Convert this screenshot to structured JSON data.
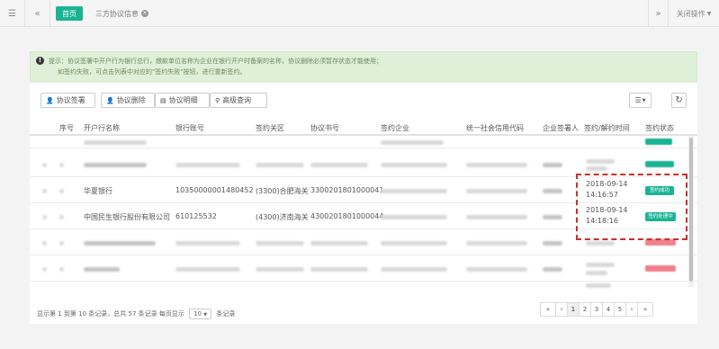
{
  "topbar": {
    "menu_icon": "menu-icon",
    "back_icon": "double-chevron-left-icon",
    "home_tab": "首页",
    "agreement_tab": "三方协议信息",
    "forward_icon": "double-chevron-right-icon",
    "close_ops": "关闭操作"
  },
  "alert": {
    "line1": "提示：协议签署中开户行为银行总行，缴款单位名称为企业在银行开户时备案的名称，协议删除必须暂存状态才能使用；",
    "line2": "如签约失败，可点击列表中对应的\"签约失败\"按钮，进行重新签约。"
  },
  "toolbar": {
    "sign": "协议签署",
    "unsign": "协议删除",
    "detail": "协议明细",
    "search": "高级查询"
  },
  "table": {
    "headers": [
      "序号",
      "开户行名称",
      "银行账号",
      "签约关区",
      "协议书号",
      "签约企业",
      "统一社会信用代码",
      "企业签署人",
      "签约/解约时间",
      "签约状态"
    ],
    "rows": [
      {
        "bank": "华夏银行",
        "account": "10350000001480452",
        "customs": "(3300)合肥海关",
        "protocol": "3300201801000041",
        "time_date": "2018-09-14",
        "time_clock": "14:16:57",
        "status": "签约成功"
      },
      {
        "bank": "中国民生银行股份有限公司",
        "account": "610125532",
        "customs": "(4300)济南海关",
        "protocol": "4300201801000044",
        "time_date": "2018-09-14",
        "time_clock": "14:18:16",
        "status": "签约处理中"
      }
    ]
  },
  "footer": {
    "info_prefix": "显示第 1 到第 10 条记录，总共 57 条记录 每页显示",
    "page_size": "10",
    "info_suffix": "条记录",
    "pages": [
      "«",
      "‹",
      "1",
      "2",
      "3",
      "4",
      "5",
      "›",
      "»"
    ],
    "active_page": "1"
  },
  "colors": {
    "accent": "#1ab394",
    "danger": "#ed5565",
    "highlight": "#c9302c",
    "alert_bg": "#dff0d8"
  }
}
